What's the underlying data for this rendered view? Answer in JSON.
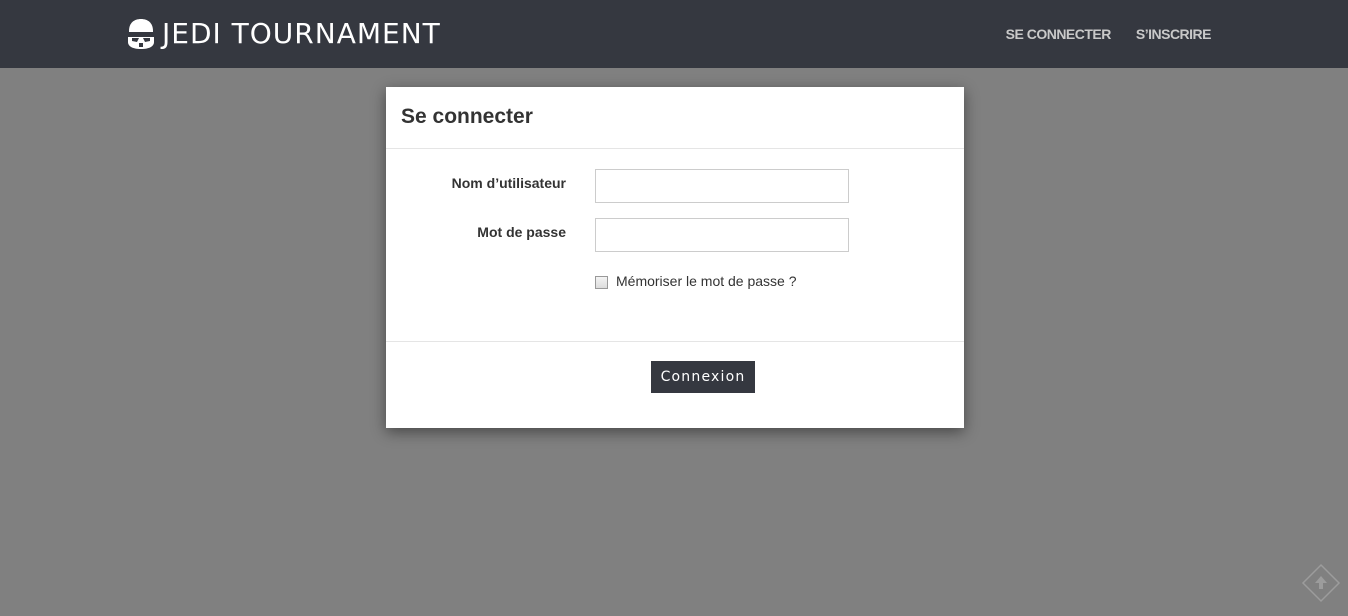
{
  "navbar": {
    "brand": "JEDI TOURNAMENT",
    "brand_icon": "stormtrooper-helmet-icon",
    "links": [
      "SE CONNECTER",
      "S’INSCRIRE"
    ]
  },
  "modal": {
    "title": "Se connecter",
    "username_label": "Nom d’utilisateur",
    "username_value": "",
    "password_label": "Mot de passe",
    "password_value": "",
    "remember_label": "Mémoriser le mot de passe ?",
    "remember_checked": false,
    "submit_label": "Connexion"
  },
  "scroll_top": {
    "icon": "arrow-up-icon"
  },
  "colors": {
    "navbar_bg": "#353840",
    "overlay": "#808080",
    "button_bg": "#353840"
  }
}
